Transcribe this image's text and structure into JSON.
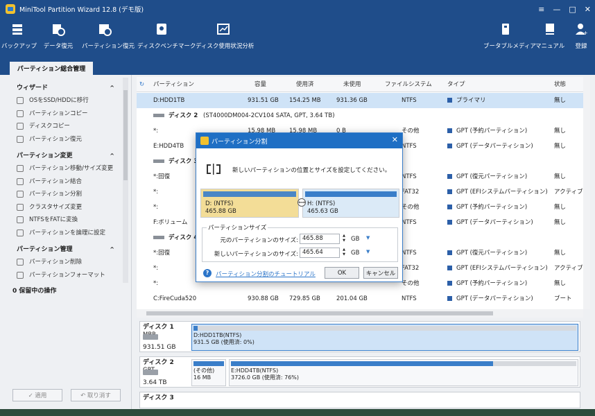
{
  "window": {
    "title": "MiniTool Partition Wizard 12.8 (デモ版)",
    "controls": [
      "≡",
      "—",
      "□",
      "✕"
    ]
  },
  "toolbar": {
    "left": [
      {
        "label": "バックアップ",
        "icon": "backup-icon"
      },
      {
        "label": "データ復元",
        "icon": "data-recovery-icon"
      },
      {
        "label": "パーティション復元",
        "icon": "partition-recovery-icon"
      },
      {
        "label": "ディスクベンチマーク",
        "icon": "disk-benchmark-icon"
      },
      {
        "label": "ディスク使用状況分析",
        "icon": "space-analyzer-icon"
      }
    ],
    "right": [
      {
        "label": "ブータブルメディア",
        "icon": "bootable-media-icon"
      },
      {
        "label": "マニュアル",
        "icon": "manual-icon"
      },
      {
        "label": "登録",
        "icon": "register-icon"
      }
    ]
  },
  "tab": {
    "label": "パーティション総合管理"
  },
  "sidebar": {
    "sections": [
      {
        "title": "ウィザード",
        "items": [
          "OSをSSD/HDDに移行",
          "パーティションコピー",
          "ディスクコピー",
          "パーティション復元"
        ]
      },
      {
        "title": "パーティション変更",
        "items": [
          "パーティション移動/サイズ変更",
          "パーティション結合",
          "パーティション分割",
          "クラスタサイズ変更",
          "NTFSをFATに変換",
          "パーティションを論理に設定"
        ]
      },
      {
        "title": "パーティション管理",
        "items": [
          "パーティション削除",
          "パーティションフォーマット"
        ]
      }
    ],
    "pending": "0 保留中の操作",
    "apply": "✓ 適用",
    "undo": "↶ 取り消す"
  },
  "grid": {
    "headers": [
      "パーティション",
      "容量",
      "使用済",
      "未使用",
      "ファイルシステム",
      "タイプ",
      "状態"
    ],
    "rows": [
      {
        "kind": "part",
        "sel": true,
        "c": [
          "D:HDD1TB",
          "931.51 GB",
          "154.25 MB",
          "931.36 GB",
          "NTFS",
          "プライマリ",
          "無し"
        ]
      },
      {
        "kind": "disk",
        "c": [
          "ディスク 2",
          "(ST4000DM004-2CV104 SATA, GPT, 3.64 TB)"
        ]
      },
      {
        "kind": "part",
        "c": [
          "*:",
          "15.98 MB",
          "15.98 MB",
          "0 B",
          "その他",
          "GPT (予約パーティション)",
          "無し"
        ]
      },
      {
        "kind": "part",
        "c": [
          "E:HDD4TB",
          "",
          "",
          "",
          "NTFS",
          "GPT (データパーティション)",
          "無し"
        ]
      },
      {
        "kind": "disk",
        "c": [
          "ディスク 3",
          ""
        ]
      },
      {
        "kind": "part",
        "c": [
          "*:回復",
          "",
          "",
          "",
          "NTFS",
          "GPT (復元パーティション)",
          "無し"
        ]
      },
      {
        "kind": "part",
        "c": [
          "*:",
          "",
          "",
          "",
          "FAT32",
          "GPT (EFIシステムパーティション)",
          "アクティブ"
        ]
      },
      {
        "kind": "part",
        "c": [
          "*:",
          "",
          "",
          "",
          "その他",
          "GPT (予約パーティション)",
          "無し"
        ]
      },
      {
        "kind": "part",
        "c": [
          "F:ボリューム",
          "",
          "",
          "",
          "NTFS",
          "GPT (データパーティション)",
          "無し"
        ]
      },
      {
        "kind": "disk",
        "c": [
          "ディスク 4",
          ""
        ]
      },
      {
        "kind": "part",
        "c": [
          "*:回復",
          "",
          "",
          "",
          "NTFS",
          "GPT (復元パーティション)",
          "無し"
        ]
      },
      {
        "kind": "part",
        "c": [
          "*:",
          "",
          "",
          "",
          "FAT32",
          "GPT (EFIシステムパーティション)",
          "アクティブ &"
        ]
      },
      {
        "kind": "part",
        "c": [
          "*:",
          "",
          "",
          "",
          "その他",
          "GPT (予約パーティション)",
          "無し"
        ]
      },
      {
        "kind": "part",
        "c": [
          "C:FireCuda520",
          "930.88 GB",
          "729.85 GB",
          "201.04 GB",
          "NTFS",
          "GPT (データパーティション)",
          "ブート"
        ]
      }
    ]
  },
  "diskmap": [
    {
      "name": "ディスク 1",
      "scheme": "MBR",
      "size": "931.51 GB",
      "parts": [
        {
          "label": "D:HDD1TB(NTFS)",
          "detail": "931.5 GB (使用済: 0%)",
          "used": 0.01
        }
      ]
    },
    {
      "name": "ディスク 2",
      "scheme": "GPT",
      "size": "3.64 TB",
      "parts": [
        {
          "label": "(その他)",
          "detail": "16 MB",
          "used": 1.0
        },
        {
          "label": "E:HDD4TB(NTFS)",
          "detail": "3726.0 GB (使用済: 76%)",
          "used": 0.76
        }
      ]
    },
    {
      "name": "ディスク 3",
      "scheme": "",
      "size": "",
      "parts": []
    }
  ],
  "dialog": {
    "title": "パーティション分割",
    "message": "新しいパーティションの位置とサイズを設定してください。",
    "left": {
      "label": "D: (NTFS)",
      "size": "465.88 GB"
    },
    "right": {
      "label": "H: (NTFS)",
      "size": "465.63 GB"
    },
    "group": "パーティションサイズ",
    "orig_label": "元のパーティションのサイズ:",
    "orig_value": "465.88",
    "new_label": "新しいパーティションのサイズ:",
    "new_value": "465.64",
    "unit": "GB",
    "help": "パーティション分割のチュートリアル",
    "ok": "OK",
    "cancel": "キャンセル"
  },
  "colors": {
    "titlebar": "#1f4d8a",
    "accent": "#2c75c9",
    "selection": "#cfe3f7"
  }
}
